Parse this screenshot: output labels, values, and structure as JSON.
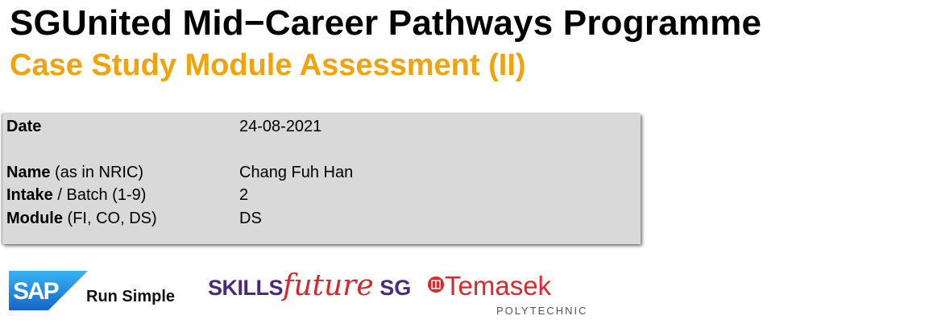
{
  "header": {
    "title": "SGUnited Mid−Career Pathways Programme",
    "subtitle": "Case Study Module Assessment (II)"
  },
  "form": {
    "rows": [
      {
        "label_bold": "Date",
        "label_rest": "",
        "value": "24-08-2021"
      },
      {
        "label_bold": "Name",
        "label_rest": " (as in NRIC)",
        "value": "Chang Fuh Han"
      },
      {
        "label_bold": "Intake",
        "label_rest": " / Batch (1-9)",
        "value": "2"
      },
      {
        "label_bold": "Module",
        "label_rest": " (FI, CO, DS)",
        "value": "DS"
      }
    ]
  },
  "logos": {
    "sap": {
      "text": "SAP",
      "tagline": "Run Simple"
    },
    "skillsfuture": {
      "part1": "SKILLS",
      "part2": "future",
      "part3": " SG"
    },
    "temasek": {
      "name": "Temasek",
      "sub": "POLYTECHNIC"
    }
  },
  "colors": {
    "subtitle": "#F0A30A",
    "box": "#d9d9d9",
    "sap_blue": "#1a8be0",
    "skills_purple": "#4b2a7b",
    "temasek_red": "#e0262b"
  }
}
